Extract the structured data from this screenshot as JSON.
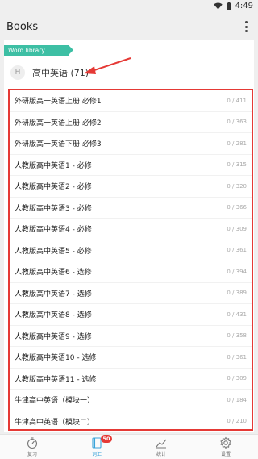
{
  "status_bar": {
    "time": "4:49"
  },
  "app_bar": {
    "title": "Books"
  },
  "library": {
    "tag": "Word library",
    "avatar_letter": "H",
    "name": "高中英语 (71)"
  },
  "books": [
    {
      "name": "外研版高一英语上册 必修1",
      "count": "0 / 411"
    },
    {
      "name": "外研版高一英语上册 必修2",
      "count": "0 / 363"
    },
    {
      "name": "外研版高一英语下册 必修3",
      "count": "0 / 281"
    },
    {
      "name": "人教版高中英语1 - 必修",
      "count": "0 / 315"
    },
    {
      "name": "人教版高中英语2 - 必修",
      "count": "0 / 320"
    },
    {
      "name": "人教版高中英语3 - 必修",
      "count": "0 / 366"
    },
    {
      "name": "人教版高中英语4 - 必修",
      "count": "0 / 309"
    },
    {
      "name": "人教版高中英语5 - 必修",
      "count": "0 / 361"
    },
    {
      "name": "人教版高中英语6 - 选修",
      "count": "0 / 394"
    },
    {
      "name": "人教版高中英语7 - 选修",
      "count": "0 / 389"
    },
    {
      "name": "人教版高中英语8 - 选修",
      "count": "0 / 431"
    },
    {
      "name": "人教版高中英语9 - 选修",
      "count": "0 / 358"
    },
    {
      "name": "人教版高中英语10 - 选修",
      "count": "0 / 361"
    },
    {
      "name": "人教版高中英语11 - 选修",
      "count": "0 / 309"
    },
    {
      "name": "牛津高中英语（模块一）",
      "count": "0 / 184"
    },
    {
      "name": "牛津高中英语（模块二）",
      "count": "0 / 210"
    }
  ],
  "nav": {
    "review": "复习",
    "words": "词汇",
    "words_badge": "50",
    "stats": "统计",
    "settings": "设置"
  },
  "colors": {
    "accent": "#3dbfa4",
    "highlight": "#e53935",
    "active": "#3aa3d9"
  },
  "icons": [
    "wifi-icon",
    "battery-icon",
    "overflow-menu-icon",
    "arrow-annotation",
    "stopwatch-icon",
    "book-icon",
    "chart-icon",
    "gear-icon"
  ]
}
